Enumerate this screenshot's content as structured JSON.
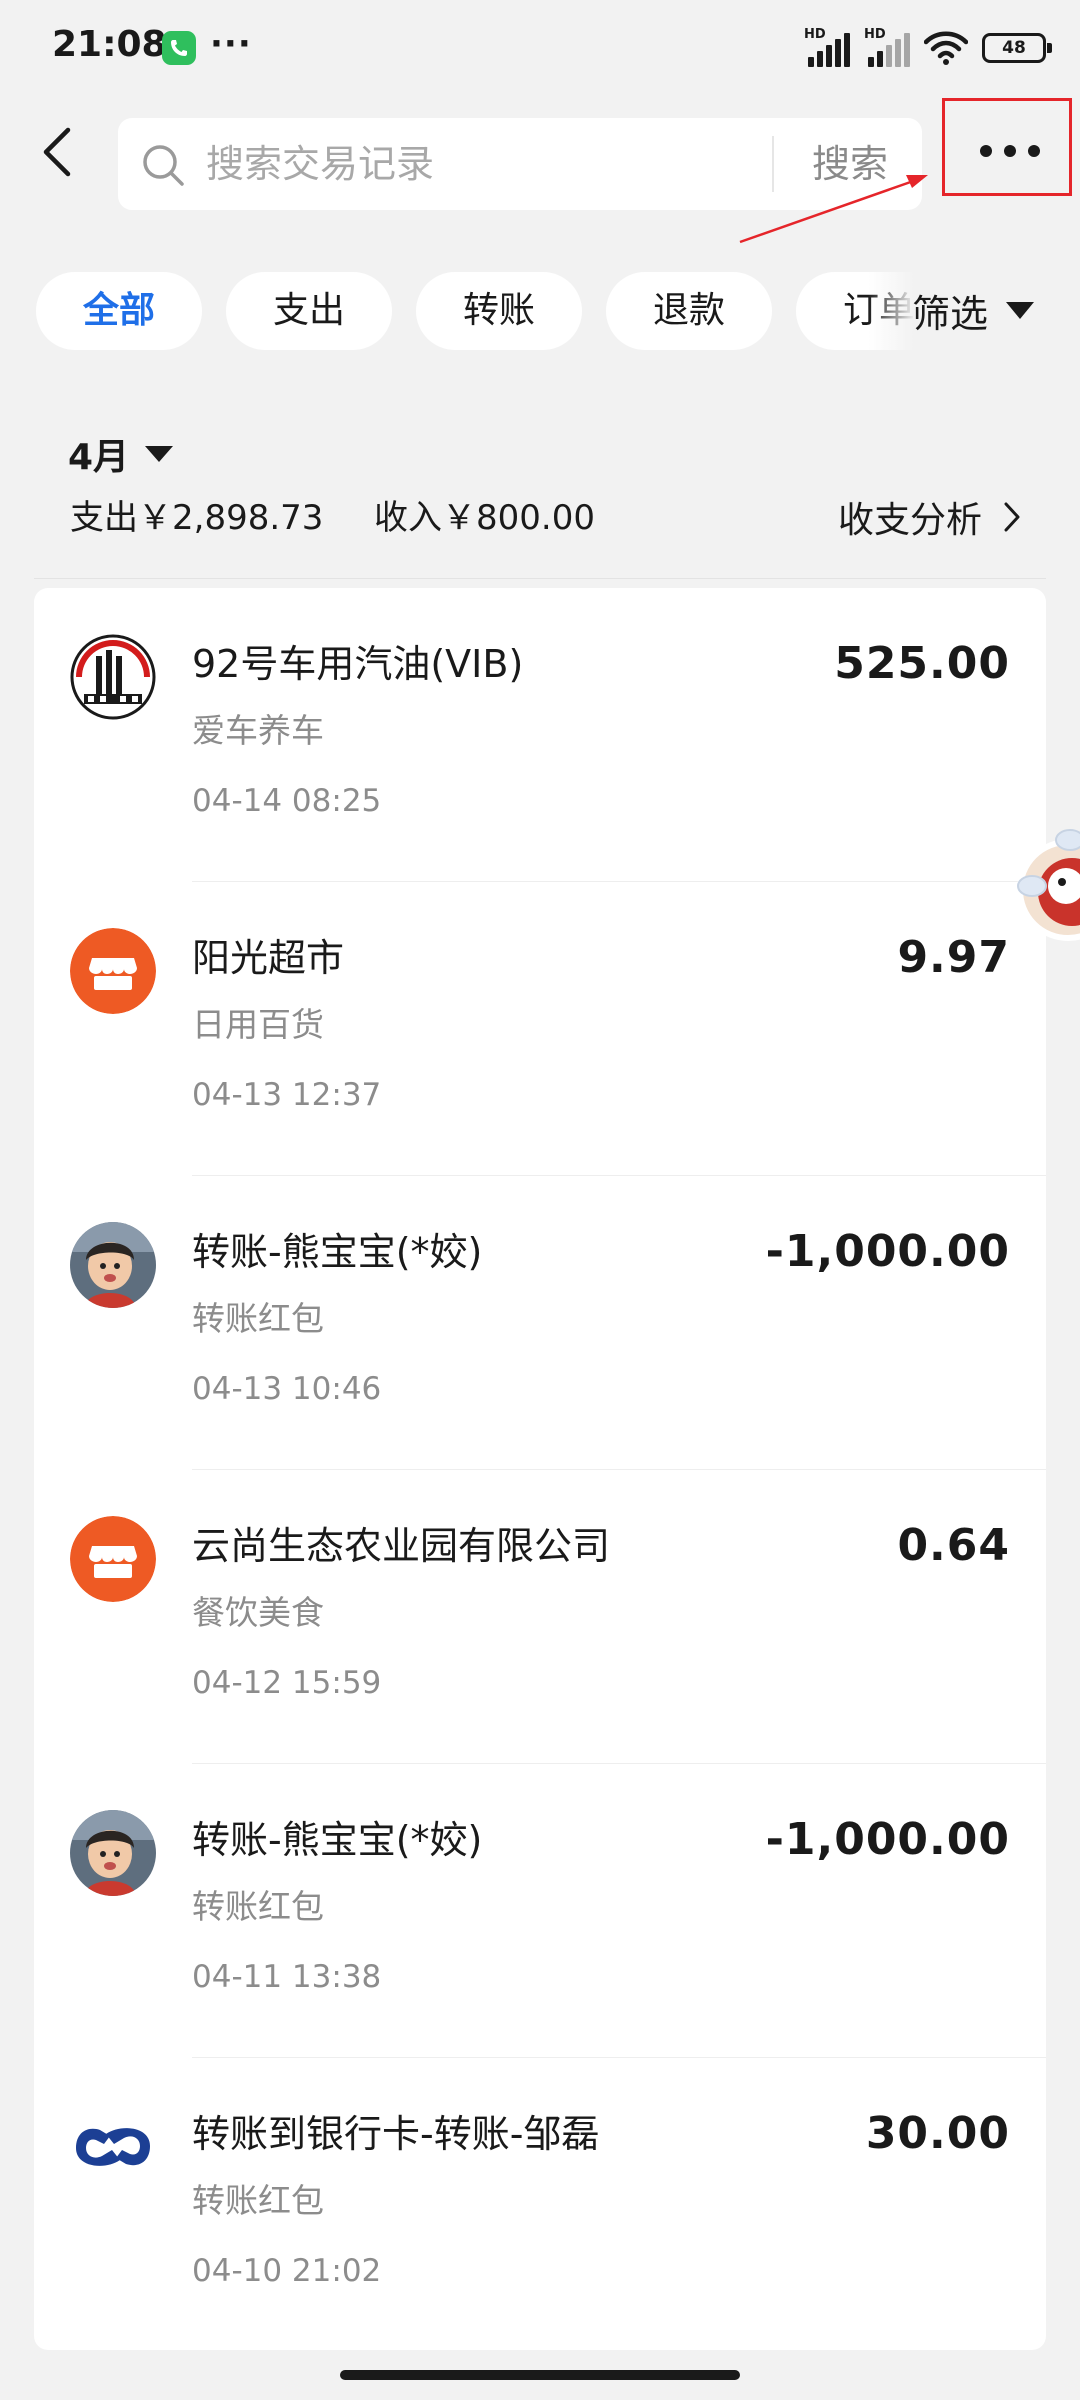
{
  "status_bar": {
    "time": "21:08",
    "more_dots": "···",
    "signal_1_label": "HD",
    "signal_2_label": "HD",
    "battery": "48",
    "icons": [
      "phone-call-icon",
      "signal-icon",
      "wifi-icon",
      "battery-icon"
    ]
  },
  "header": {
    "back_icon": "chevron-left-icon",
    "search_placeholder": "搜索交易记录",
    "search_button": "搜索",
    "more_icon": "more-horizontal-icon",
    "annotation_color": "#e5252a"
  },
  "tabs": {
    "items": [
      {
        "label": "全部",
        "active": true
      },
      {
        "label": "支出",
        "active": false
      },
      {
        "label": "转账",
        "active": false
      },
      {
        "label": "退款",
        "active": false
      },
      {
        "label": "订单",
        "active": false
      }
    ],
    "filter_label": "筛选",
    "active_color": "#1f6fe8"
  },
  "summary": {
    "month": "4月",
    "expense": "支出￥2,898.73",
    "income": "收入￥800.00",
    "analysis": "收支分析"
  },
  "transactions": [
    {
      "name": "92号车用汽油(VIB)",
      "category": "爱车养车",
      "time": "04-14 08:25",
      "amount": "525.00",
      "logo": "sinopec-logo-icon"
    },
    {
      "name": "阳光超市",
      "category": "日用百货",
      "time": "04-13 12:37",
      "amount": "9.97",
      "logo": "store-icon"
    },
    {
      "name": "转账-熊宝宝(*姣)",
      "category": "转账红包",
      "time": "04-13 10:46",
      "amount": "-1,000.00",
      "logo": "user-avatar-photo"
    },
    {
      "name": "云尚生态农业园有限公司",
      "category": "餐饮美食",
      "time": "04-12 15:59",
      "amount": "0.64",
      "logo": "store-icon"
    },
    {
      "name": "转账-熊宝宝(*姣)",
      "category": "转账红包",
      "time": "04-11 13:38",
      "amount": "-1,000.00",
      "logo": "user-avatar-photo"
    },
    {
      "name": "转账到银行卡-转账-邹磊",
      "category": "转账红包",
      "time": "04-10 21:02",
      "amount": "30.00",
      "logo": "bank-logo-icon"
    }
  ],
  "colors": {
    "store_orange": "#ee5a24",
    "bank_blue": "#1c3f94",
    "background": "#f2f2f2"
  }
}
